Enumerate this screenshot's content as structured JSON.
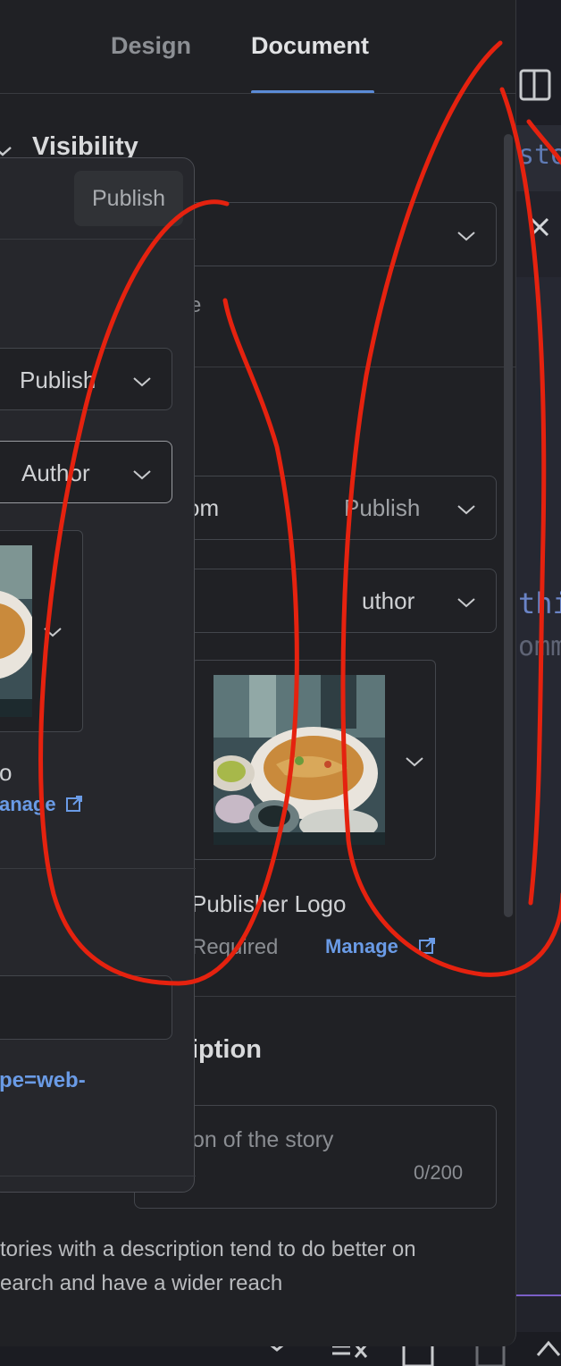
{
  "tabs": {
    "design": "Design",
    "document": "Document"
  },
  "visibility": {
    "title": "Visibility",
    "hint_fragment": "e"
  },
  "story_details": {
    "publisher_select": {
      "prefix": "om",
      "value": "Publish"
    },
    "author_select": {
      "value": "uthor"
    },
    "logo_caption": "Publisher Logo",
    "logo_required": "Required",
    "manage_link": "Manage"
  },
  "description": {
    "title_fragment": "iption",
    "placeholder_fragment": "on of the story",
    "counter": "0/200",
    "hint_line1": "tories with a description tend to do better on",
    "hint_line2": "earch and have a wider reach"
  },
  "popup": {
    "publish_button": "Publish",
    "publisher_select": "Publish",
    "author_select": "Author",
    "logo_caption_fragment": "o",
    "manage_fragment": "anage",
    "url_fragment": "pe=web-"
  },
  "editor_strip": {
    "tab_fragment": "stor",
    "code_line1": "thi",
    "code_line2": "omm"
  },
  "colors": {
    "accent": "#5b8bd7",
    "link": "#6a9be6",
    "annotation": "#e5220f"
  }
}
